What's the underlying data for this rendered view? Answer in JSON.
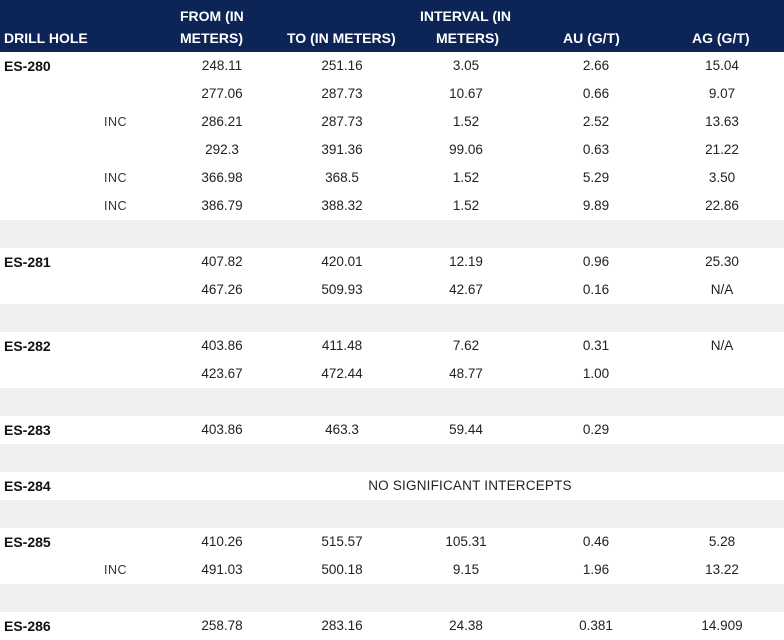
{
  "headers": {
    "drill_hole": "DRILL HOLE",
    "from_line1": "FROM (IN",
    "from_line2": "METERS)",
    "to": "TO (IN METERS)",
    "interval_line1": "INTERVAL (IN",
    "interval_line2": "METERS)",
    "au": "AU (G/T)",
    "ag": "AG (G/T)"
  },
  "rows": [
    {
      "hole": "ES-280",
      "inc": "",
      "from": "248.11",
      "to": "251.16",
      "interval": "3.05",
      "au": "2.66",
      "ag": "15.04"
    },
    {
      "hole": "",
      "inc": "",
      "from": "277.06",
      "to": "287.73",
      "interval": "10.67",
      "au": "0.66",
      "ag": "9.07"
    },
    {
      "hole": "",
      "inc": "INC",
      "from": "286.21",
      "to": "287.73",
      "interval": "1.52",
      "au": "2.52",
      "ag": "13.63"
    },
    {
      "hole": "",
      "inc": "",
      "from": "292.3",
      "to": "391.36",
      "interval": "99.06",
      "au": "0.63",
      "ag": "21.22"
    },
    {
      "hole": "",
      "inc": "INC",
      "from": "366.98",
      "to": "368.5",
      "interval": "1.52",
      "au": "5.29",
      "ag": "3.50"
    },
    {
      "hole": "",
      "inc": "INC",
      "from": "386.79",
      "to": "388.32",
      "interval": "1.52",
      "au": "9.89",
      "ag": "22.86"
    },
    {
      "gap": true
    },
    {
      "hole": "ES-281",
      "inc": "",
      "from": "407.82",
      "to": "420.01",
      "interval": "12.19",
      "au": "0.96",
      "ag": "25.30"
    },
    {
      "hole": "",
      "inc": "",
      "from": "467.26",
      "to": "509.93",
      "interval": "42.67",
      "au": "0.16",
      "ag": "N/A"
    },
    {
      "gap": true
    },
    {
      "hole": "ES-282",
      "inc": "",
      "from": "403.86",
      "to": "411.48",
      "interval": "7.62",
      "au": "0.31",
      "ag": "N/A"
    },
    {
      "hole": "",
      "inc": "",
      "from": "423.67",
      "to": "472.44",
      "interval": "48.77",
      "au": "1.00",
      "ag": ""
    },
    {
      "gap": true
    },
    {
      "hole": "ES-283",
      "inc": "",
      "from": "403.86",
      "to": "463.3",
      "interval": "59.44",
      "au": "0.29",
      "ag": ""
    },
    {
      "gap": true
    },
    {
      "hole": "ES-284",
      "note": "NO SIGNIFICANT INTERCEPTS"
    },
    {
      "gap": true
    },
    {
      "hole": "ES-285",
      "inc": "",
      "from": "410.26",
      "to": "515.57",
      "interval": "105.31",
      "au": "0.46",
      "ag": "5.28"
    },
    {
      "hole": "",
      "inc": "INC",
      "from": "491.03",
      "to": "500.18",
      "interval": "9.15",
      "au": "1.96",
      "ag": "13.22"
    },
    {
      "gap": true
    },
    {
      "hole": "ES-286",
      "inc": "",
      "from": "258.78",
      "to": "283.16",
      "interval": "24.38",
      "au": "0.381",
      "ag": "14.909"
    }
  ]
}
